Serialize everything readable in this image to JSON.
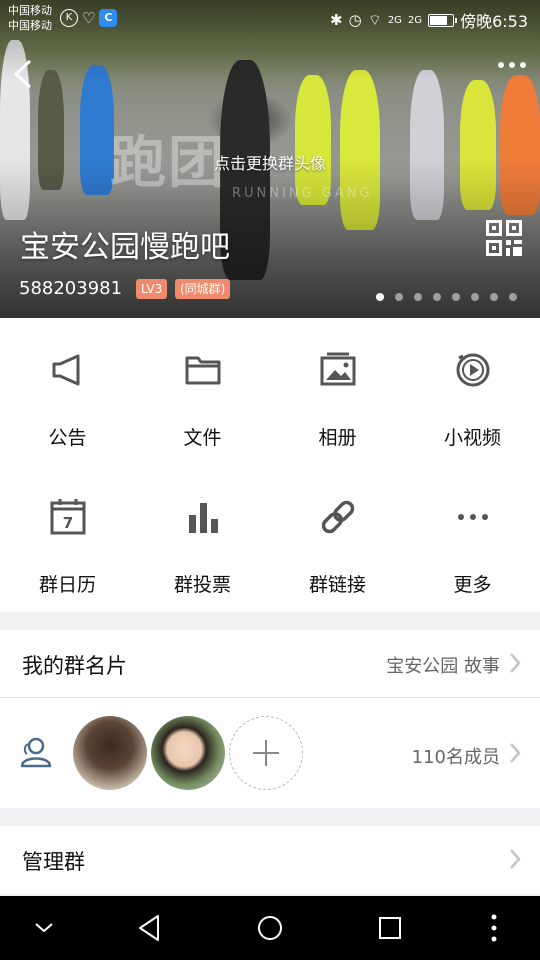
{
  "status_bar": {
    "carrier_1": "中国移动",
    "carrier_2": "中国移动",
    "time": "傍晚6:53",
    "signal_1": "2G",
    "signal_2": "2G"
  },
  "hero": {
    "change_avatar_text": "点击更换群头像",
    "watermark": "跑团",
    "watermark_sub": "RUNNING GANG",
    "group_name": "宝安公园慢跑吧",
    "group_id": "588203981",
    "level_badge": "LV3",
    "city_badge": "(同城群)",
    "page_count": 8,
    "active_page": 0
  },
  "features": [
    {
      "label": "公告",
      "icon": "megaphone-icon"
    },
    {
      "label": "文件",
      "icon": "folder-icon"
    },
    {
      "label": "相册",
      "icon": "photo-album-icon"
    },
    {
      "label": "小视频",
      "icon": "video-play-icon"
    },
    {
      "label": "群日历",
      "icon": "calendar-icon",
      "calendar_day": "7"
    },
    {
      "label": "群投票",
      "icon": "bar-chart-icon"
    },
    {
      "label": "群链接",
      "icon": "link-icon"
    },
    {
      "label": "更多",
      "icon": "more-dots-icon"
    }
  ],
  "group_card": {
    "title": "我的群名片",
    "value": "宝安公园 故事"
  },
  "members": {
    "count_label": "110名成员"
  },
  "manage": {
    "title": "管理群"
  },
  "colors": {
    "accent_badge": "#f08a6c",
    "icon_gray": "#555555"
  }
}
